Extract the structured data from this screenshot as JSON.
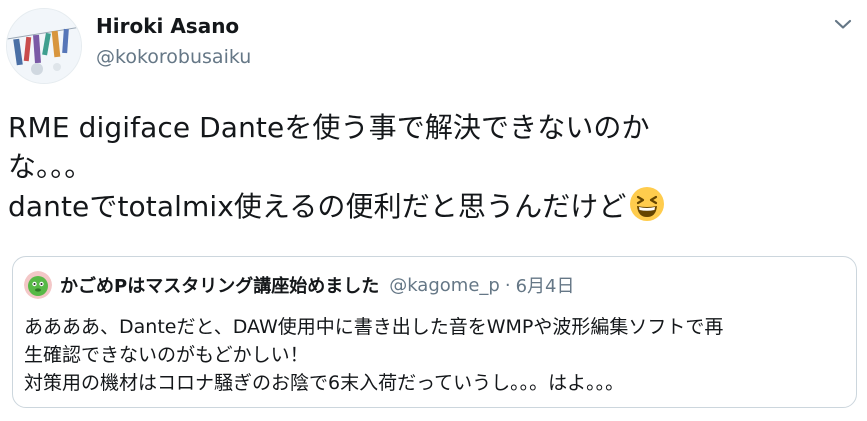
{
  "author": {
    "name": "Hiroki Asano",
    "handle": "@kokorobusaiku",
    "avatar_icon": "profile-photo"
  },
  "menu": {
    "icon": "chevron-down-icon"
  },
  "tweet": {
    "lines": [
      "RME digiface Danteを使う事で解決できないのか",
      "な。。。",
      "danteでtotalmix使えるの便利だと思うんだけど"
    ],
    "emoji": "grinning-squinting-face"
  },
  "quote": {
    "author_name": "かごめPはマスタリング講座始めました",
    "author_handle": "@kagome_p",
    "separator": "·",
    "date": "6月4日",
    "avatar_icon": "green-character-avatar",
    "lines": [
      "ああああ、Danteだと、DAW使用中に書き出した音をWMPや波形編集ソフトで再",
      "生確認できないのがもどかしい！",
      "対策用の機材はコロナ騒ぎのお陰で6末入荷だっていうし。。。はよ。。。"
    ]
  },
  "colors": {
    "text": "#14171a",
    "secondary": "#657786",
    "border": "#ccd6dd",
    "emoji": "#ffcc4d"
  }
}
